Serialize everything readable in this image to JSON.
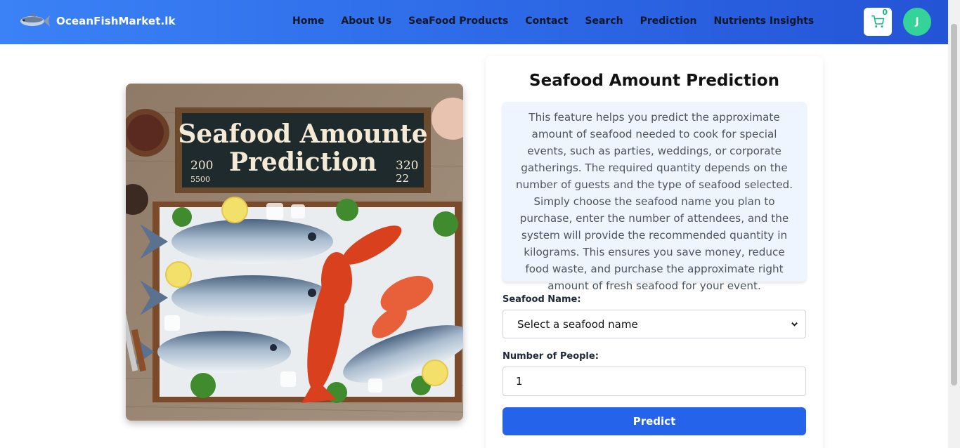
{
  "brand": {
    "name": "OceanFishMarket.lk"
  },
  "nav": {
    "links": [
      "Home",
      "About Us",
      "SeaFood Products",
      "Contact",
      "Search",
      "Prediction",
      "Nutrients Insights"
    ]
  },
  "cart": {
    "count": "0",
    "icon": "cart-icon"
  },
  "user": {
    "avatar_initial": "J"
  },
  "hero": {
    "sign_line1": "Seafood Amounte",
    "sign_line2": "Prediction",
    "sign_left_num1": "200",
    "sign_left_num2": "5500",
    "sign_right_num1": "320",
    "sign_right_num2": "22"
  },
  "form": {
    "title": "Seafood Amount Prediction",
    "description": "This feature helps you predict the approximate amount of seafood needed to cook for special events, such as parties, weddings, or corporate gatherings. The required quantity depends on the number of guests and the type of seafood selected. Simply choose the seafood name you plan to purchase, enter the number of attendees, and the system will provide the recommended quantity in kilograms. This ensures you save money, reduce food waste, and purchase the approximate right amount of fresh seafood for your event.",
    "seafood_label": "Seafood Name:",
    "seafood_selected": "Select a seafood name",
    "people_label": "Number of People:",
    "people_value": "1",
    "predict_label": "Predict"
  },
  "colors": {
    "nav_start": "#3b82f6",
    "nav_end": "#2454d6",
    "button": "#2563eb",
    "avatar": "#34d399",
    "desc_bg": "#eff5ff"
  }
}
